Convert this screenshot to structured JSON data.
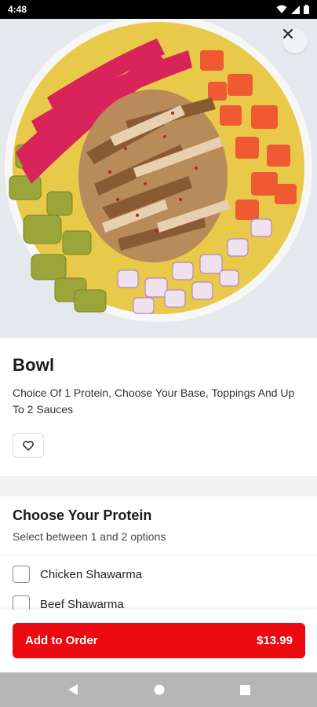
{
  "status_bar": {
    "time": "4:48"
  },
  "hero": {
    "image": "bowl-food-photo",
    "close_icon": "close-icon"
  },
  "item": {
    "title": "Bowl",
    "description": "Choice Of 1 Protein, Choose Your Base, Toppings And Up To 2 Sauces",
    "favorite_icon": "heart-outline-icon"
  },
  "protein_section": {
    "title": "Choose Your Protein",
    "subtitle": "Select between 1 and 2 options",
    "options": [
      {
        "label": "Chicken Shawarma",
        "checked": false
      },
      {
        "label": "Beef Shawarma",
        "checked": false
      }
    ]
  },
  "footer": {
    "add_label": "Add to Order",
    "price": "$13.99",
    "accent_color": "#ea0a10"
  },
  "nav_bar": {
    "icons": [
      "back-icon",
      "home-icon",
      "recents-icon"
    ]
  }
}
